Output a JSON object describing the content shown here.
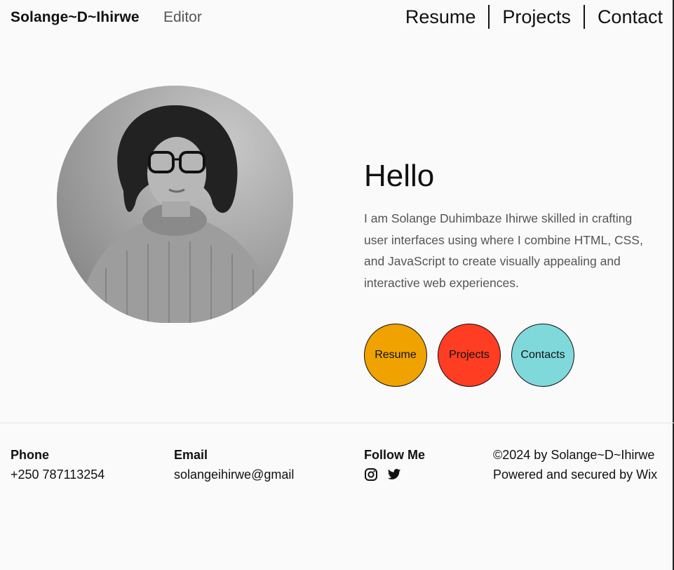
{
  "header": {
    "brand": "Solange~D~Ihirwe",
    "role": "Editor",
    "nav": [
      {
        "label": "Resume"
      },
      {
        "label": "Projects"
      },
      {
        "label": "Contact"
      }
    ]
  },
  "hero": {
    "heading": "Hello",
    "intro": "I am Solange Duhimbaze Ihirwe skilled in crafting user interfaces using where I combine HTML, CSS, and JavaScript to create visually appealing and interactive web experiences.",
    "buttons": [
      {
        "label": "Resume",
        "color": "#f0a200"
      },
      {
        "label": "Projects",
        "color": "#ff3d22"
      },
      {
        "label": "Contacts",
        "color": "#7fd9db"
      }
    ]
  },
  "footer": {
    "phone_label": "Phone",
    "phone": "+250 787113254",
    "email_label": "Email",
    "email": "solangeihirwe@gmail",
    "follow_label": "Follow Me",
    "social_icons": [
      "instagram-icon",
      "twitter-icon"
    ],
    "copyright": "©2024 by Solange~D~Ihirwe",
    "powered": "Powered and secured by Wix"
  }
}
